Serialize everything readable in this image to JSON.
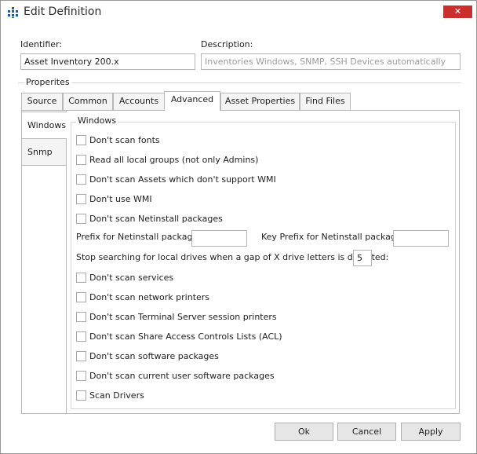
{
  "window": {
    "title": "Edit Definition",
    "close_glyph": "✕",
    "icon": "grid-dots-icon",
    "close_color": "#c9302c"
  },
  "form": {
    "identifier_label": "Identifier:",
    "identifier_value": "Asset Inventory 200.x",
    "description_label": "Description:",
    "description_value": "Inventories Windows, SNMP, SSH Devices automatically"
  },
  "group": {
    "label": "Properites"
  },
  "tabs": [
    {
      "label": "Source"
    },
    {
      "label": "Common"
    },
    {
      "label": "Accounts"
    },
    {
      "label": "Advanced"
    },
    {
      "label": "Asset Properties"
    },
    {
      "label": "Find Files"
    }
  ],
  "active_tab": "Advanced",
  "side_tabs": [
    {
      "label": "Windows"
    },
    {
      "label": "Snmp"
    }
  ],
  "panel": {
    "legend": "Windows",
    "checks_top": [
      "Don't scan fonts",
      "Read all local groups (not only Admins)",
      "Don't scan Assets which don't support WMI",
      "Don't use WMI",
      "Don't scan Netinstall packages"
    ],
    "prefix_label": "Prefix for Netinstall packages:",
    "prefix_value": "",
    "key_prefix_label": "Key Prefix for Netinstall packages:",
    "key_prefix_value": "",
    "drive_gap_label": "Stop searching for local drives when a gap of X drive letters is detected:",
    "drive_gap_value": "5",
    "checks_bottom": [
      "Don't scan services",
      "Don't scan network printers",
      "Don't scan Terminal Server session printers",
      "Don't scan Share Access Controls Lists (ACL)",
      "Don't scan software packages",
      "Don't scan current user software packages",
      "Scan Drivers"
    ]
  },
  "buttons": {
    "ok": "Ok",
    "cancel": "Cancel",
    "apply": "Apply"
  }
}
